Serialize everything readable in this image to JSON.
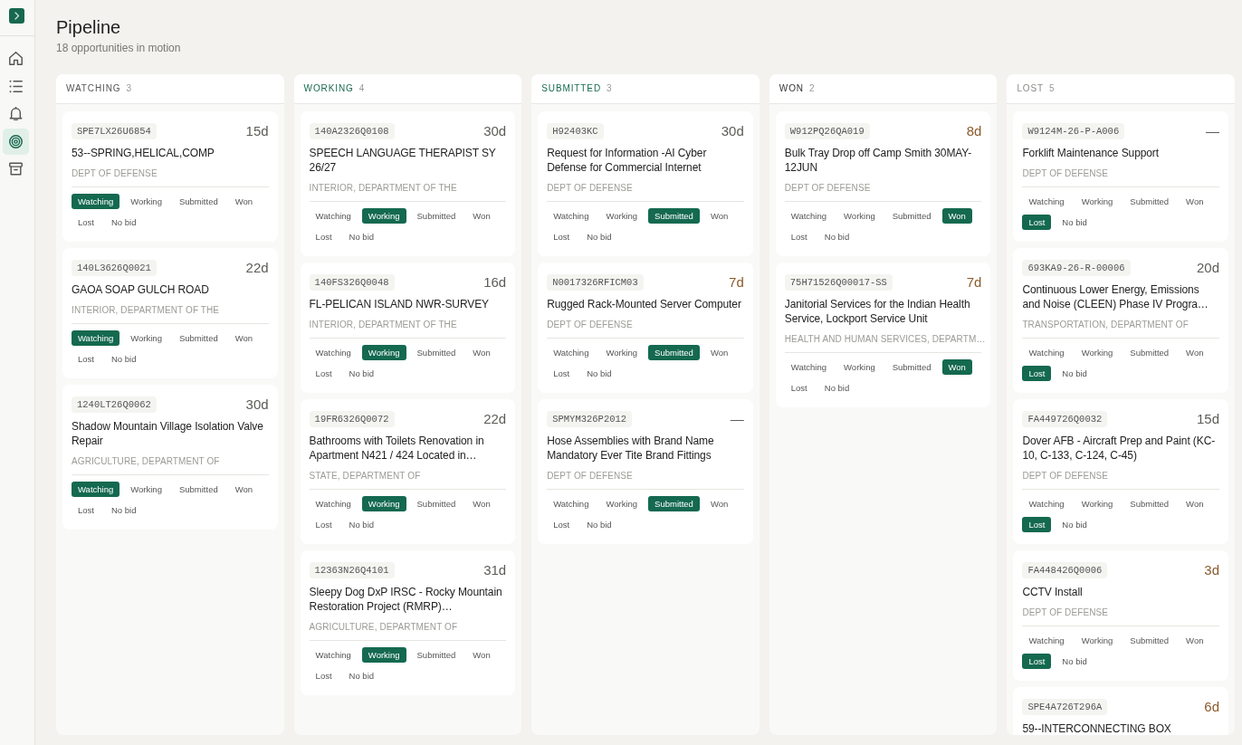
{
  "sidebar": {
    "items": [
      {
        "kind": "home",
        "selected": false
      },
      {
        "kind": "list",
        "selected": false
      },
      {
        "kind": "bell",
        "selected": false
      },
      {
        "kind": "target",
        "selected": true
      },
      {
        "kind": "archive",
        "selected": false
      }
    ]
  },
  "page": {
    "title": "Pipeline",
    "subtitle": "18 opportunities in motion"
  },
  "columns": [
    {
      "name": "WATCHING",
      "count": "3",
      "color": "#555555",
      "cards": [
        {
          "id": "SPE7LX26U6854",
          "days": "15d",
          "urgent": false,
          "title": "53--SPRING,HELICAL,COMP",
          "agency": "DEPT OF DEFENSE",
          "statuses": [
            {
              "label": "Watching",
              "selected": true
            },
            {
              "label": "Working",
              "selected": false
            },
            {
              "label": "Submitted",
              "selected": false
            },
            {
              "label": "Won",
              "selected": false
            },
            {
              "label": "Lost",
              "selected": false
            },
            {
              "label": "No bid",
              "selected": false
            }
          ]
        },
        {
          "id": "140L3626Q0021",
          "days": "22d",
          "urgent": false,
          "title": "GAOA SOAP GULCH ROAD",
          "agency": "INTERIOR, DEPARTMENT OF THE",
          "statuses": [
            {
              "label": "Watching",
              "selected": true
            },
            {
              "label": "Working",
              "selected": false
            },
            {
              "label": "Submitted",
              "selected": false
            },
            {
              "label": "Won",
              "selected": false
            },
            {
              "label": "Lost",
              "selected": false
            },
            {
              "label": "No bid",
              "selected": false
            }
          ]
        },
        {
          "id": "1240LT26Q0062",
          "days": "30d",
          "urgent": false,
          "title": "Shadow Mountain Village Isolation Valve Repair",
          "agency": "AGRICULTURE, DEPARTMENT OF",
          "statuses": [
            {
              "label": "Watching",
              "selected": true
            },
            {
              "label": "Working",
              "selected": false
            },
            {
              "label": "Submitted",
              "selected": false
            },
            {
              "label": "Won",
              "selected": false
            },
            {
              "label": "Lost",
              "selected": false
            },
            {
              "label": "No bid",
              "selected": false
            }
          ]
        }
      ]
    },
    {
      "name": "WORKING",
      "count": "4",
      "color": "#1a6b50",
      "cards": [
        {
          "id": "140A2326Q0108",
          "days": "30d",
          "urgent": false,
          "title": "SPEECH LANGUAGE THERAPIST SY 26/27",
          "agency": "INTERIOR, DEPARTMENT OF THE",
          "statuses": [
            {
              "label": "Watching",
              "selected": false
            },
            {
              "label": "Working",
              "selected": true
            },
            {
              "label": "Submitted",
              "selected": false
            },
            {
              "label": "Won",
              "selected": false
            },
            {
              "label": "Lost",
              "selected": false
            },
            {
              "label": "No bid",
              "selected": false
            }
          ]
        },
        {
          "id": "140FS326Q0048",
          "days": "16d",
          "urgent": false,
          "title": "FL-PELICAN ISLAND NWR-SURVEY",
          "agency": "INTERIOR, DEPARTMENT OF THE",
          "statuses": [
            {
              "label": "Watching",
              "selected": false
            },
            {
              "label": "Working",
              "selected": true
            },
            {
              "label": "Submitted",
              "selected": false
            },
            {
              "label": "Won",
              "selected": false
            },
            {
              "label": "Lost",
              "selected": false
            },
            {
              "label": "No bid",
              "selected": false
            }
          ]
        },
        {
          "id": "19FR6326Q0072",
          "days": "22d",
          "urgent": false,
          "title": "Bathrooms with Toilets Renovation in Apartment N421 / 424 Located in…",
          "agency": "STATE, DEPARTMENT OF",
          "statuses": [
            {
              "label": "Watching",
              "selected": false
            },
            {
              "label": "Working",
              "selected": true
            },
            {
              "label": "Submitted",
              "selected": false
            },
            {
              "label": "Won",
              "selected": false
            },
            {
              "label": "Lost",
              "selected": false
            },
            {
              "label": "No bid",
              "selected": false
            }
          ]
        },
        {
          "id": "12363N26Q4101",
          "days": "31d",
          "urgent": false,
          "title": "Sleepy Dog DxP IRSC - Rocky Mountain Restoration Project (RMRP)…",
          "agency": "AGRICULTURE, DEPARTMENT OF",
          "statuses": [
            {
              "label": "Watching",
              "selected": false
            },
            {
              "label": "Working",
              "selected": true
            },
            {
              "label": "Submitted",
              "selected": false
            },
            {
              "label": "Won",
              "selected": false
            },
            {
              "label": "Lost",
              "selected": false
            },
            {
              "label": "No bid",
              "selected": false
            }
          ]
        }
      ]
    },
    {
      "name": "SUBMITTED",
      "count": "3",
      "color": "#1a6b50",
      "cards": [
        {
          "id": "H92403KC",
          "days": "30d",
          "urgent": false,
          "title": "Request for Information -AI Cyber Defense for Commercial Internet",
          "agency": "DEPT OF DEFENSE",
          "statuses": [
            {
              "label": "Watching",
              "selected": false
            },
            {
              "label": "Working",
              "selected": false
            },
            {
              "label": "Submitted",
              "selected": true
            },
            {
              "label": "Won",
              "selected": false
            },
            {
              "label": "Lost",
              "selected": false
            },
            {
              "label": "No bid",
              "selected": false
            }
          ]
        },
        {
          "id": "N0017326RFICM03",
          "days": "7d",
          "urgent": true,
          "title": "Rugged Rack-Mounted Server Computer",
          "agency": "DEPT OF DEFENSE",
          "statuses": [
            {
              "label": "Watching",
              "selected": false
            },
            {
              "label": "Working",
              "selected": false
            },
            {
              "label": "Submitted",
              "selected": true
            },
            {
              "label": "Won",
              "selected": false
            },
            {
              "label": "Lost",
              "selected": false
            },
            {
              "label": "No bid",
              "selected": false
            }
          ]
        },
        {
          "id": "SPMYM326P2012",
          "days": "—",
          "urgent": false,
          "title": "Hose Assemblies with Brand Name Mandatory Ever Tite Brand Fittings",
          "agency": "DEPT OF DEFENSE",
          "statuses": [
            {
              "label": "Watching",
              "selected": false
            },
            {
              "label": "Working",
              "selected": false
            },
            {
              "label": "Submitted",
              "selected": true
            },
            {
              "label": "Won",
              "selected": false
            },
            {
              "label": "Lost",
              "selected": false
            },
            {
              "label": "No bid",
              "selected": false
            }
          ]
        }
      ]
    },
    {
      "name": "WON",
      "count": "2",
      "color": "#333333",
      "cards": [
        {
          "id": "W912PQ26QA019",
          "days": "8d",
          "urgent": true,
          "title": "Bulk Tray Drop off Camp Smith 30MAY-12JUN",
          "agency": "DEPT OF DEFENSE",
          "statuses": [
            {
              "label": "Watching",
              "selected": false
            },
            {
              "label": "Working",
              "selected": false
            },
            {
              "label": "Submitted",
              "selected": false
            },
            {
              "label": "Won",
              "selected": true
            },
            {
              "label": "Lost",
              "selected": false
            },
            {
              "label": "No bid",
              "selected": false
            }
          ]
        },
        {
          "id": "75H71526Q00017-SS",
          "days": "7d",
          "urgent": true,
          "title": "Janitorial Services for the Indian Health Service, Lockport Service Unit",
          "agency": "HEALTH AND HUMAN SERVICES, DEPARTM…",
          "statuses": [
            {
              "label": "Watching",
              "selected": false
            },
            {
              "label": "Working",
              "selected": false
            },
            {
              "label": "Submitted",
              "selected": false
            },
            {
              "label": "Won",
              "selected": true
            },
            {
              "label": "Lost",
              "selected": false
            },
            {
              "label": "No bid",
              "selected": false
            }
          ]
        }
      ]
    },
    {
      "name": "LOST",
      "count": "5",
      "color": "#8a8a86",
      "cards": [
        {
          "id": "W9124M-26-P-A006",
          "days": "—",
          "urgent": false,
          "title": "Forklift Maintenance Support",
          "agency": "DEPT OF DEFENSE",
          "statuses": [
            {
              "label": "Watching",
              "selected": false
            },
            {
              "label": "Working",
              "selected": false
            },
            {
              "label": "Submitted",
              "selected": false
            },
            {
              "label": "Won",
              "selected": false
            },
            {
              "label": "Lost",
              "selected": true
            },
            {
              "label": "No bid",
              "selected": false
            }
          ]
        },
        {
          "id": "693KA9-26-R-00006",
          "days": "20d",
          "urgent": false,
          "title": "Continuous Lower Energy, Emissions and Noise (CLEEN) Phase IV Progra…",
          "agency": "TRANSPORTATION, DEPARTMENT OF",
          "statuses": [
            {
              "label": "Watching",
              "selected": false
            },
            {
              "label": "Working",
              "selected": false
            },
            {
              "label": "Submitted",
              "selected": false
            },
            {
              "label": "Won",
              "selected": false
            },
            {
              "label": "Lost",
              "selected": true
            },
            {
              "label": "No bid",
              "selected": false
            }
          ]
        },
        {
          "id": "FA449726Q0032",
          "days": "15d",
          "urgent": false,
          "title": "Dover AFB - Aircraft Prep and Paint (KC-10, C-133, C-124, C-45)",
          "agency": "DEPT OF DEFENSE",
          "statuses": [
            {
              "label": "Watching",
              "selected": false
            },
            {
              "label": "Working",
              "selected": false
            },
            {
              "label": "Submitted",
              "selected": false
            },
            {
              "label": "Won",
              "selected": false
            },
            {
              "label": "Lost",
              "selected": true
            },
            {
              "label": "No bid",
              "selected": false
            }
          ]
        },
        {
          "id": "FA448426Q0006",
          "days": "3d",
          "urgent": true,
          "title": "CCTV Install",
          "agency": "DEPT OF DEFENSE",
          "statuses": [
            {
              "label": "Watching",
              "selected": false
            },
            {
              "label": "Working",
              "selected": false
            },
            {
              "label": "Submitted",
              "selected": false
            },
            {
              "label": "Won",
              "selected": false
            },
            {
              "label": "Lost",
              "selected": true
            },
            {
              "label": "No bid",
              "selected": false
            }
          ]
        },
        {
          "id": "SPE4A726T296A",
          "days": "6d",
          "urgent": true,
          "title": "59--INTERCONNECTING BOX"
        }
      ]
    }
  ]
}
